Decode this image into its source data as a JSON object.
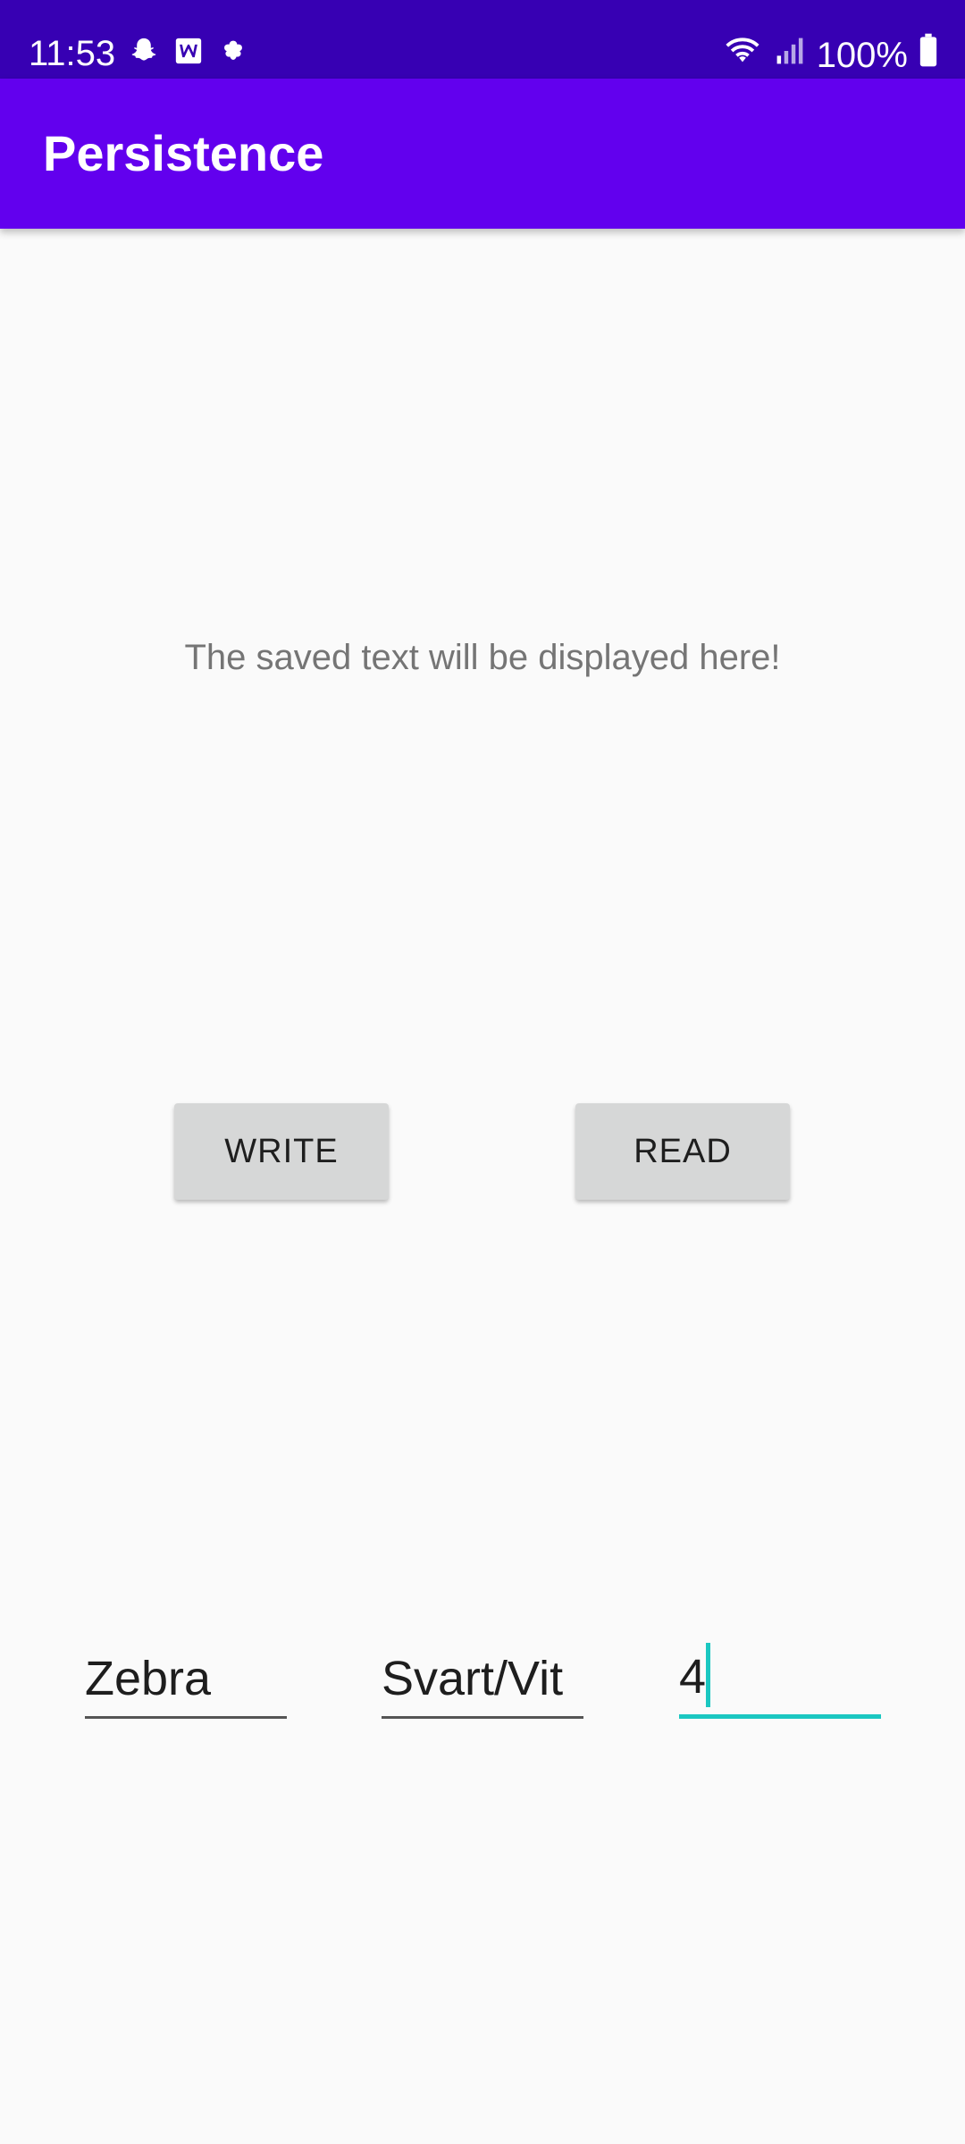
{
  "status_bar": {
    "time": "11:53",
    "left_icons": [
      "snapchat-icon",
      "word-icon",
      "notification-icon"
    ],
    "battery": "100%"
  },
  "app_bar": {
    "title": "Persistence"
  },
  "main": {
    "saved_text": "The saved text will be displayed here!",
    "write_label": "WRITE",
    "read_label": "READ"
  },
  "inputs": {
    "field1_value": "Zebra",
    "field2_value": "Svart/Vit",
    "field3_value": "4"
  },
  "colors": {
    "status_bar": "#3700b3",
    "app_bar": "#6200ee",
    "focus_accent": "#1bc7c1"
  }
}
